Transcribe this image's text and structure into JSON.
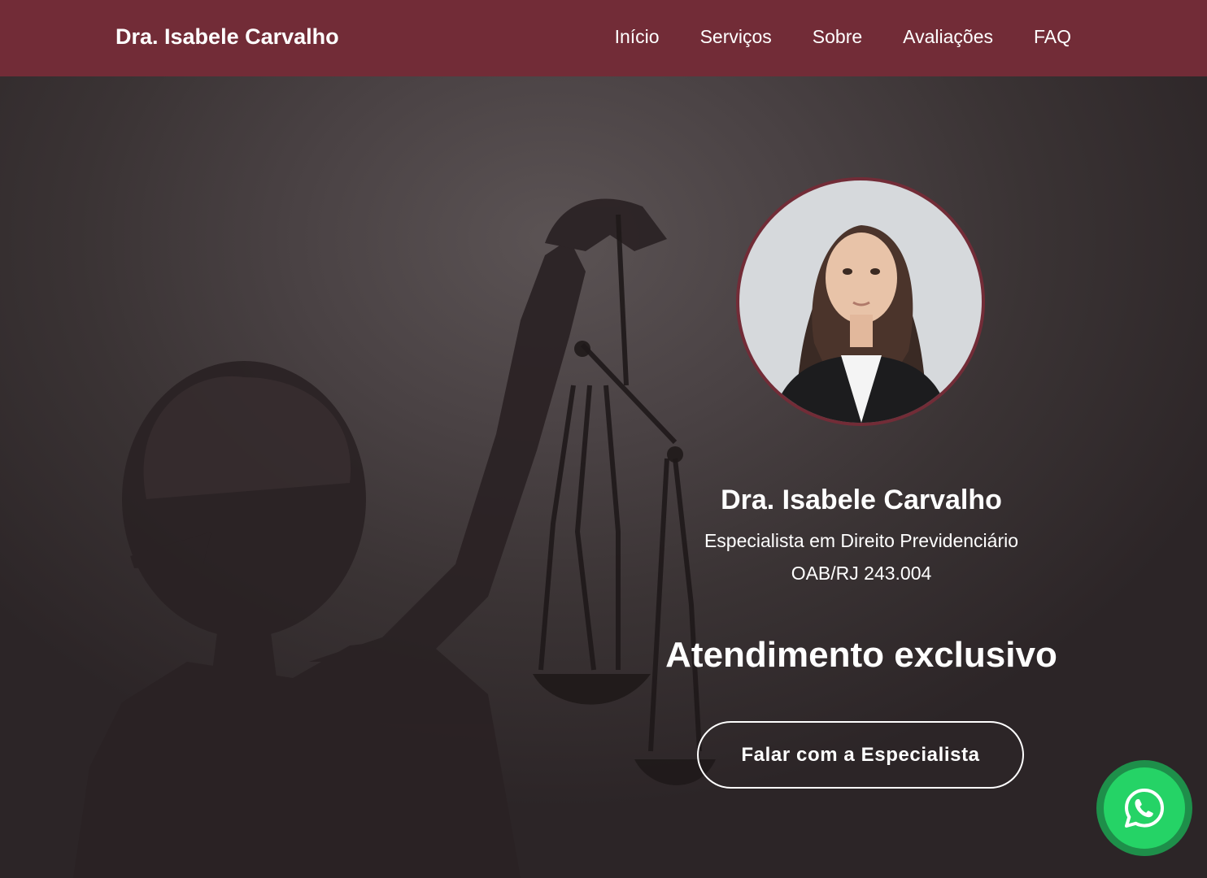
{
  "navbar": {
    "brand": "Dra. Isabele Carvalho",
    "links": [
      {
        "label": "Início"
      },
      {
        "label": "Serviços"
      },
      {
        "label": "Sobre"
      },
      {
        "label": "Avaliações"
      },
      {
        "label": "FAQ"
      }
    ]
  },
  "hero": {
    "name": "Dra. Isabele Carvalho",
    "specialty": "Especialista em Direito Previdenciário",
    "oab": "OAB/RJ 243.004",
    "headline": "Atendimento exclusivo",
    "cta_label": "Falar com a Especialista"
  },
  "floating": {
    "icon": "whatsapp-icon"
  },
  "colors": {
    "brand": "#722c37",
    "whatsapp": "#25d366",
    "text": "#ffffff"
  }
}
